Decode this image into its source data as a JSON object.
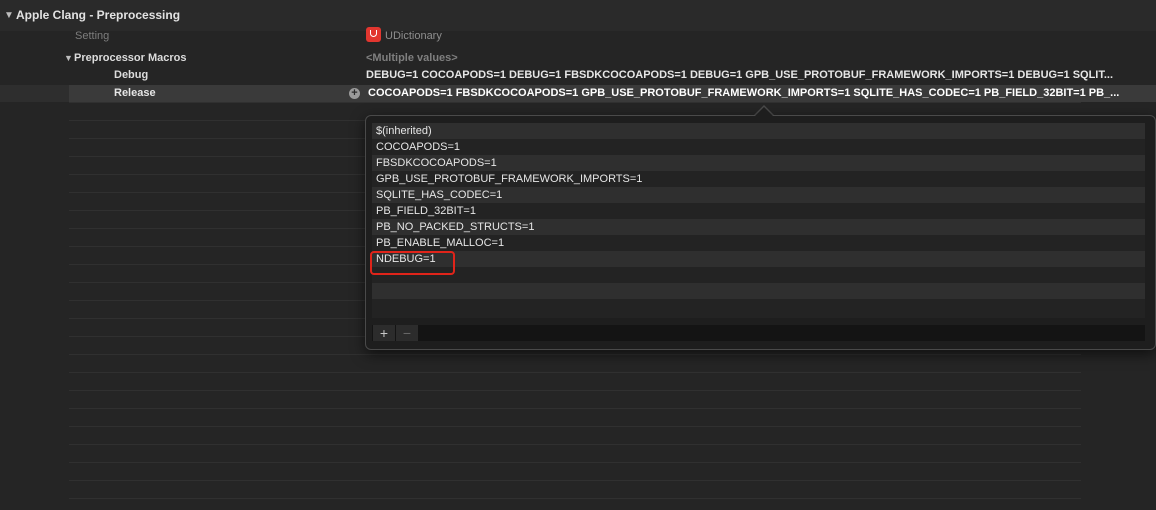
{
  "section": {
    "title": "Apple Clang - Preprocessing"
  },
  "header_row": {
    "setting_label": "Setting",
    "target_name": "UDictionary"
  },
  "macros": {
    "label": "Preprocessor Macros",
    "resolved_value": "<Multiple values>"
  },
  "debug": {
    "label": "Debug",
    "value": "DEBUG=1  COCOAPODS=1 DEBUG=1  FBSDKCOCOAPODS=1 DEBUG=1  GPB_USE_PROTOBUF_FRAMEWORK_IMPORTS=1 DEBUG=1  SQLIT..."
  },
  "release": {
    "label": "Release",
    "value": "COCOAPODS=1  FBSDKCOCOAPODS=1  GPB_USE_PROTOBUF_FRAMEWORK_IMPORTS=1  SQLITE_HAS_CODEC=1  PB_FIELD_32BIT=1 PB_..."
  },
  "popover": {
    "items": [
      "$(inherited)",
      "COCOAPODS=1",
      "FBSDKCOCOAPODS=1",
      "GPB_USE_PROTOBUF_FRAMEWORK_IMPORTS=1",
      "SQLITE_HAS_CODEC=1",
      "PB_FIELD_32BIT=1",
      "PB_NO_PACKED_STRUCTS=1",
      "PB_ENABLE_MALLOC=1",
      "NDEBUG=1"
    ],
    "add_label": "+",
    "remove_label": "−"
  },
  "colors": {
    "highlight": "#e0241a",
    "target_icon": "#e2362f"
  }
}
